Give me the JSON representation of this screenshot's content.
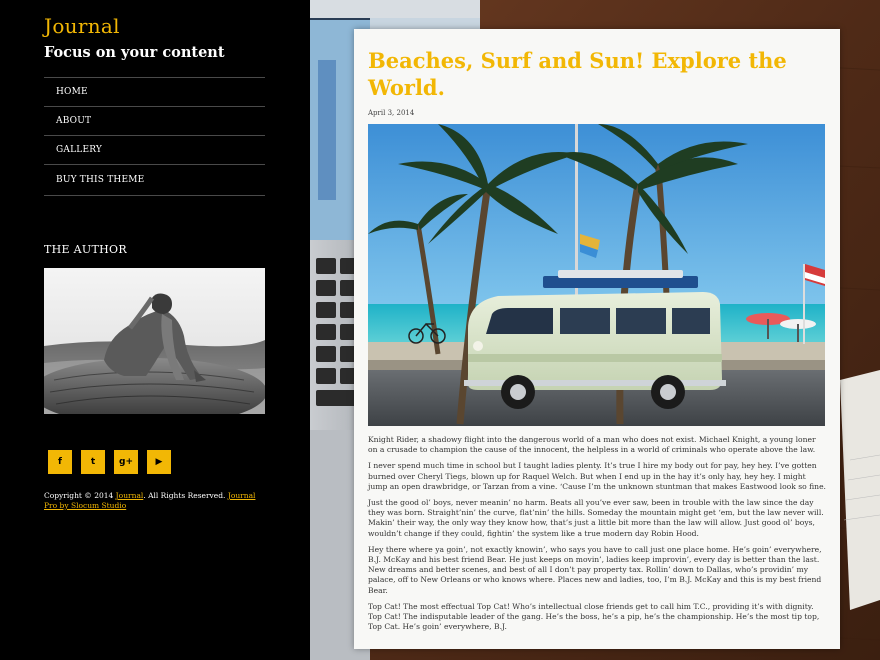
{
  "site": {
    "title": "Journal",
    "tagline": "Focus on your content"
  },
  "nav": {
    "items": [
      "HOME",
      "ABOUT",
      "GALLERY",
      "BUY THIS THEME"
    ]
  },
  "widget": {
    "author_heading": "THE AUTHOR"
  },
  "social": [
    {
      "icon": "facebook-icon",
      "glyph": "f"
    },
    {
      "icon": "twitter-icon",
      "glyph": "t"
    },
    {
      "icon": "google-plus-icon",
      "glyph": "g+"
    },
    {
      "icon": "youtube-icon",
      "glyph": "▶"
    }
  ],
  "footer": {
    "copyright_prefix": "Copyright © 2014 ",
    "site_link": "Journal",
    "rights": ". All Rights Reserved. ",
    "credit_link": "Journal Pro by Slocum Studio"
  },
  "post": {
    "title": "Beaches, Surf and Sun! Explore the World.",
    "date": "April 3, 2014",
    "paragraphs": [
      "Knight Rider, a shadowy flight into the dangerous world of a man who does not exist. Michael Knight, a young loner on a crusade to champion the cause of the innocent, the helpless in a world of criminals who operate above the law.",
      "I never spend much time in school but I taught ladies plenty. It’s true I hire my body out for pay, hey hey. I’ve gotten burned over Cheryl Tiegs, blown up for Raquel Welch. But when I end up in the hay it’s only hay, hey hey. I might jump an open drawbridge, or Tarzan from a vine. ‘Cause I’m the unknown stuntman that makes Eastwood look so fine.",
      "Just the good ol’ boys, never meanin’ no harm. Beats all you’ve ever saw, been in trouble with the law since the day they was born. Straight’nin’ the curve, flat’nin’ the hills. Someday the mountain might get ‘em, but the law never will. Makin’ their way, the only way they know how, that’s just a little bit more than the law will allow. Just good ol’ boys, wouldn’t change if they could, fightin’ the system like a true modern day Robin Hood.",
      "Hey there where ya goin’, not exactly knowin’, who says you have to call just one place home. He’s goin’ everywhere, B.J. McKay and his best friend Bear. He just keeps on movin’, ladies keep improvin’, every day is better than the last. New dreams and better scenes, and best of all I don’t pay property tax. Rollin’ down to Dallas, who’s providin’ my palace, off to New Orleans or who knows where. Places new and ladies, too, I’m B.J. McKay and this is my best friend Bear.",
      "Top Cat! The most effectual Top Cat! Who’s intellectual close friends get to call him T.C., providing it’s with dignity. Top Cat! The indisputable leader of the gang. He’s the boss, he’s a pip, he’s the championship. He’s the most tip top, Top Cat. He’s goin’ everywhere, B.J."
    ]
  },
  "colors": {
    "accent": "#f2b705",
    "sidebar_bg": "#000000",
    "card_bg": "#f8f8f6"
  }
}
